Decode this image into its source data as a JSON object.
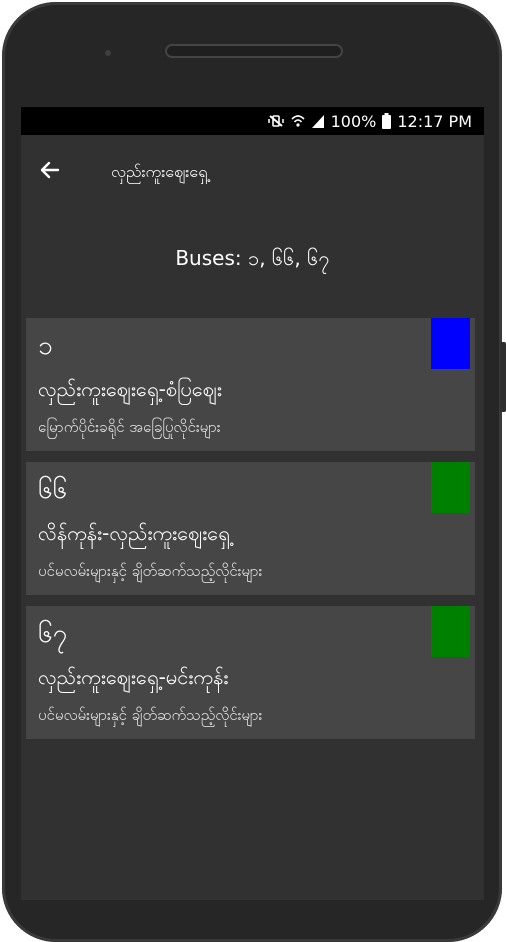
{
  "status_bar": {
    "battery": "100%",
    "time": "12:17 PM"
  },
  "app_bar": {
    "title": "လှည်းကူးဈေးရှေ့"
  },
  "buses_line": "Buses: ၁, ၆၆, ၆၇",
  "routes": [
    {
      "number": "၁",
      "name": "လှည်းကူးဈေးရှေ့-စံပြဈေး",
      "type": "မြောက်ပိုင်းခရိုင် အခြေပြုလိုင်းများ",
      "color": "#0000ff"
    },
    {
      "number": "၆၆",
      "name": "လိန်ကုန်း-လှည်းကူးဈေးရှေ့",
      "type": "ပင်မလမ်းများနှင့် ချိတ်ဆက်သည့်လိုင်းများ",
      "color": "#008000"
    },
    {
      "number": "၆၇",
      "name": "လှည်းကူးဈေးရှေ့-မင်းကုန်း",
      "type": "ပင်မလမ်းများနှင့် ချိတ်ဆက်သည့်လိုင်းများ",
      "color": "#008000"
    }
  ],
  "icons": {
    "back": "arrow-left-icon",
    "mute": "vibrate-mute-icon",
    "wifi": "wifi-icon",
    "signal": "signal-icon",
    "battery": "battery-icon"
  }
}
